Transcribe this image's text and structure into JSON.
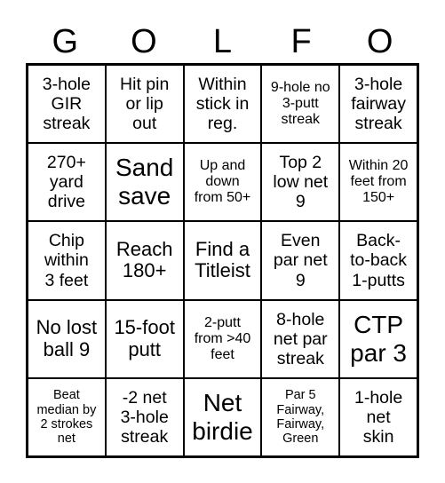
{
  "header": [
    "G",
    "O",
    "L",
    "F",
    "O"
  ],
  "cells": [
    [
      "3-hole\nGIR\nstreak",
      "Hit pin\nor lip\nout",
      "Within\nstick in\nreg.",
      "9-hole no\n3-putt\nstreak",
      "3-hole\nfairway\nstreak"
    ],
    [
      "270+\nyard\ndrive",
      "Sand\nsave",
      "Up and\ndown\nfrom 50+",
      "Top 2\nlow net\n9",
      "Within 20\nfeet from\n150+"
    ],
    [
      "Chip\nwithin\n3 feet",
      "Reach\n180+",
      "Find a\nTitleist",
      "Even\npar net\n9",
      "Back-\nto-back\n1-putts"
    ],
    [
      "No lost\nball 9",
      "15-foot\nputt",
      "2-putt\nfrom >40\nfeet",
      "8-hole\nnet par\nstreak",
      "CTP\npar 3"
    ],
    [
      "Beat\nmedian by\n2 strokes\nnet",
      "-2 net\n3-hole\nstreak",
      "Net\nbirdie",
      "Par 5\nFairway,\nFairway,\nGreen",
      "1-hole\nnet\nskin"
    ]
  ]
}
